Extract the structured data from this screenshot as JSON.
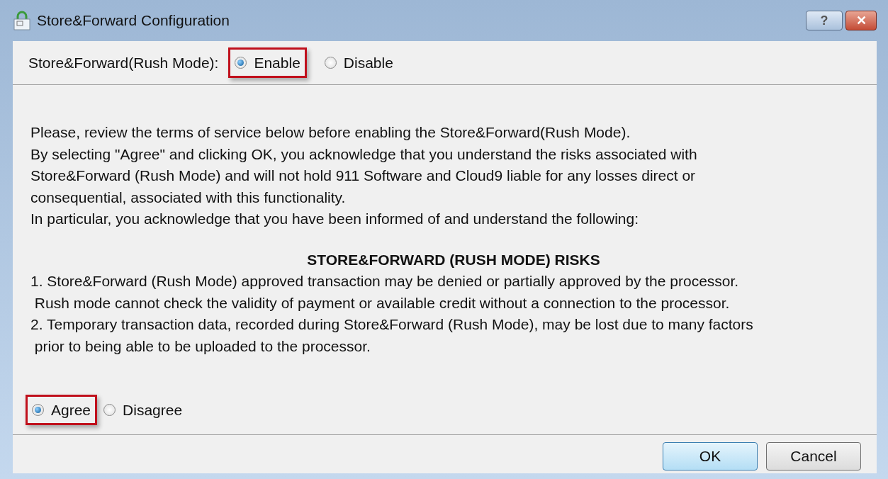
{
  "window": {
    "title": "Store&Forward Configuration",
    "buttons": [
      {
        "kind": "help",
        "label": "?"
      },
      {
        "kind": "close",
        "label": "✕"
      }
    ]
  },
  "mode": {
    "label": "Store&Forward(Rush Mode):",
    "options": [
      {
        "label": "Enable",
        "selected": true,
        "highlighted": true
      },
      {
        "label": "Disable",
        "selected": false,
        "highlighted": false
      }
    ]
  },
  "terms": {
    "lines": [
      "Please, review the terms of service below before enabling the Store&Forward(Rush Mode).",
      "By selecting \"Agree\" and clicking OK, you acknowledge that you understand the risks associated with",
      "Store&Forward (Rush Mode) and will not hold 911 Software and Cloud9 liable for any losses direct or",
      "consequential, associated with this functionality.",
      "In particular, you acknowledge that you have been informed of and understand the following:"
    ],
    "risks_heading": "STORE&FORWARD (RUSH MODE) RISKS",
    "risks": [
      [
        "1. Store&Forward (Rush Mode) approved transaction may be denied or partially approved by the processor.",
        " Rush mode cannot check the validity of payment or available credit without a connection to the processor."
      ],
      [
        "2. Temporary transaction data, recorded during Store&Forward (Rush Mode), may be lost due to many factors",
        " prior to being able to be uploaded to the processor."
      ]
    ]
  },
  "agreement": {
    "options": [
      {
        "label": "Agree",
        "selected": true,
        "highlighted": true
      },
      {
        "label": "Disagree",
        "selected": false,
        "highlighted": false
      }
    ]
  },
  "footer_buttons": [
    {
      "label": "OK",
      "kind": "default"
    },
    {
      "label": "Cancel",
      "kind": "normal"
    }
  ]
}
